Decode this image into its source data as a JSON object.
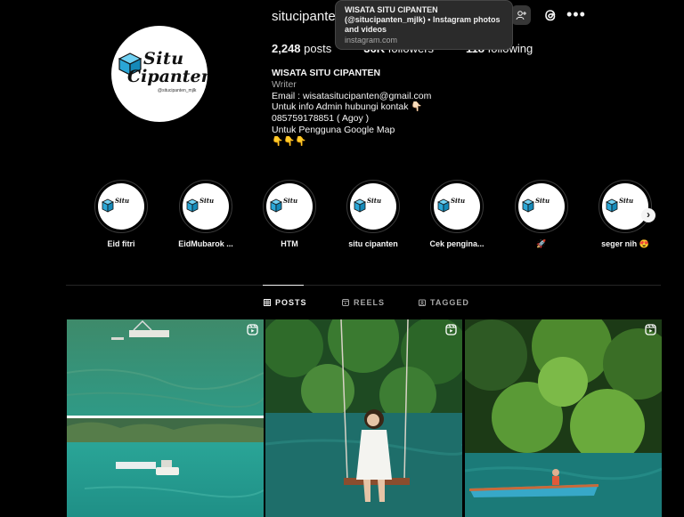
{
  "profile": {
    "username": "situcipanten",
    "logo": {
      "line1": "Situ",
      "line2": "Cipanten",
      "handle": "@situcipanten_mjlk"
    },
    "stats": {
      "posts_count": "2,248",
      "posts_label": "posts",
      "followers_count": "36K",
      "followers_label": "followers",
      "following_count": "118",
      "following_label": "following"
    },
    "bio": {
      "name": "WISATA SITU CIPANTEN",
      "category": "Writer",
      "lines": [
        "Email : wisatasitucipanten@gmail.com",
        "Untuk info Admin hubungi kontak 👇🏻",
        "085759178851 ( Agoy )",
        "Untuk Pengguna Google Map",
        "👇👇👇"
      ]
    }
  },
  "tooltip": {
    "title": "WISATA SITU CIPANTEN (@situcipanten_mjlk) • Instagram photos and videos",
    "domain": "instagram.com"
  },
  "highlights": [
    {
      "label": "Eid fitri"
    },
    {
      "label": "EidMubarok ..."
    },
    {
      "label": "HTM"
    },
    {
      "label": "situ cipanten"
    },
    {
      "label": "Cek pengina..."
    },
    {
      "label": "🚀"
    },
    {
      "label": "seger nih 😍"
    }
  ],
  "tabs": {
    "posts": "POSTS",
    "reels": "REELS",
    "tagged": "TAGGED"
  },
  "icons": [
    "add-user-icon",
    "threads-icon",
    "more-icon",
    "chevron-right-icon",
    "grid-icon",
    "reels-icon",
    "tagged-icon",
    "reel-badge-icon"
  ],
  "colors": {
    "background": "#000000",
    "text": "#f5f5f5",
    "secondary": "#a8a8a8",
    "divider": "#262626",
    "logo_blue": "#2aa6d6"
  }
}
